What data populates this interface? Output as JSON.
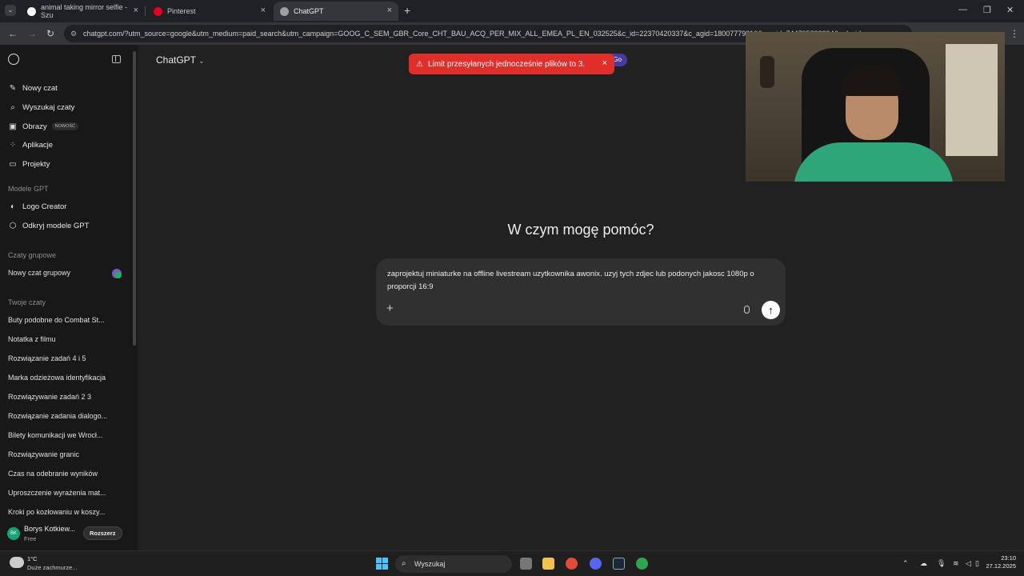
{
  "browser": {
    "tabs": [
      {
        "title": "animal taking mirror selfie - Szu",
        "favicon_color": "#ffffff"
      },
      {
        "title": "Pinterest",
        "favicon_color": "#e60023"
      },
      {
        "title": "ChatGPT",
        "favicon_color": "#9aa0a6",
        "active": true
      }
    ],
    "new_tab_symbol": "+",
    "url": "chatgpt.com/?utm_source=google&utm_medium=paid_search&utm_campaign=GOOG_C_SEM_GBR_Core_CHT_BAU_ACQ_PER_MIX_ALL_EMEA_PL_EN_032525&c_id=22370420337&c_agid=18007779310&c_crid=744795898394&c_kwid="
  },
  "sidebar": {
    "top_items": [
      {
        "label": "Nowy czat",
        "icon": "edit-icon"
      },
      {
        "label": "Wyszukaj czaty",
        "icon": "search-icon"
      },
      {
        "label": "Obrazy",
        "icon": "image-icon",
        "badge": "NOWOŚĆ"
      },
      {
        "label": "Aplikacje",
        "icon": "apps-icon"
      },
      {
        "label": "Projekty",
        "icon": "folder-icon"
      }
    ],
    "gpt_section_title": "Modele GPT",
    "gpt_items": [
      {
        "label": "Logo Creator",
        "icon": "logo-icon"
      },
      {
        "label": "Odkryj modele GPT",
        "icon": "cube-icon"
      }
    ],
    "group_section_title": "Czaty grupowe",
    "group_item": "Nowy czat grupowy",
    "chats_section_title": "Twoje czaty",
    "chats": [
      "Buty podobne do Combat St...",
      "Notatka z filmu",
      "Rozwiązanie zadań 4 i 5",
      "Marka odzieżowa identyfikacja",
      "Rozwiązywanie zadań 2 3",
      "Rozwiązanie zadania dialogo...",
      "Bilety komunikacji we Wrocł...",
      "Rozwiązywanie granic",
      "Czas na odebranie wyników",
      "Uproszczenie wyrażenia mat...",
      "Kroki po kozłowaniu w koszy..."
    ],
    "user": {
      "initials": "BK",
      "name": "Borys Kotkiew...",
      "plan": "Free",
      "upgrade_label": "Rozszerz"
    }
  },
  "main": {
    "model_selector": "ChatGPT",
    "toast": {
      "message": "Limit przesyłanych jednocześnie plików to 3.",
      "behind_label": "Go"
    },
    "heading": "W czym mogę pomóc?",
    "prompt_text": "zaprojektuj miniaturke na offline livestream uzytkownika awonix. uzyj tych zdjec lub podonych jakosc 1080p o proporcji 16:9"
  },
  "taskbar": {
    "temperature": "1°C",
    "condition": "Duże zachmurze...",
    "search_label": "Wyszukaj",
    "time": "23:10",
    "date": "27.12.2025"
  },
  "colors": {
    "accent_error": "#e02e2a",
    "sidebar_bg": "#181818",
    "main_bg": "#212121"
  }
}
